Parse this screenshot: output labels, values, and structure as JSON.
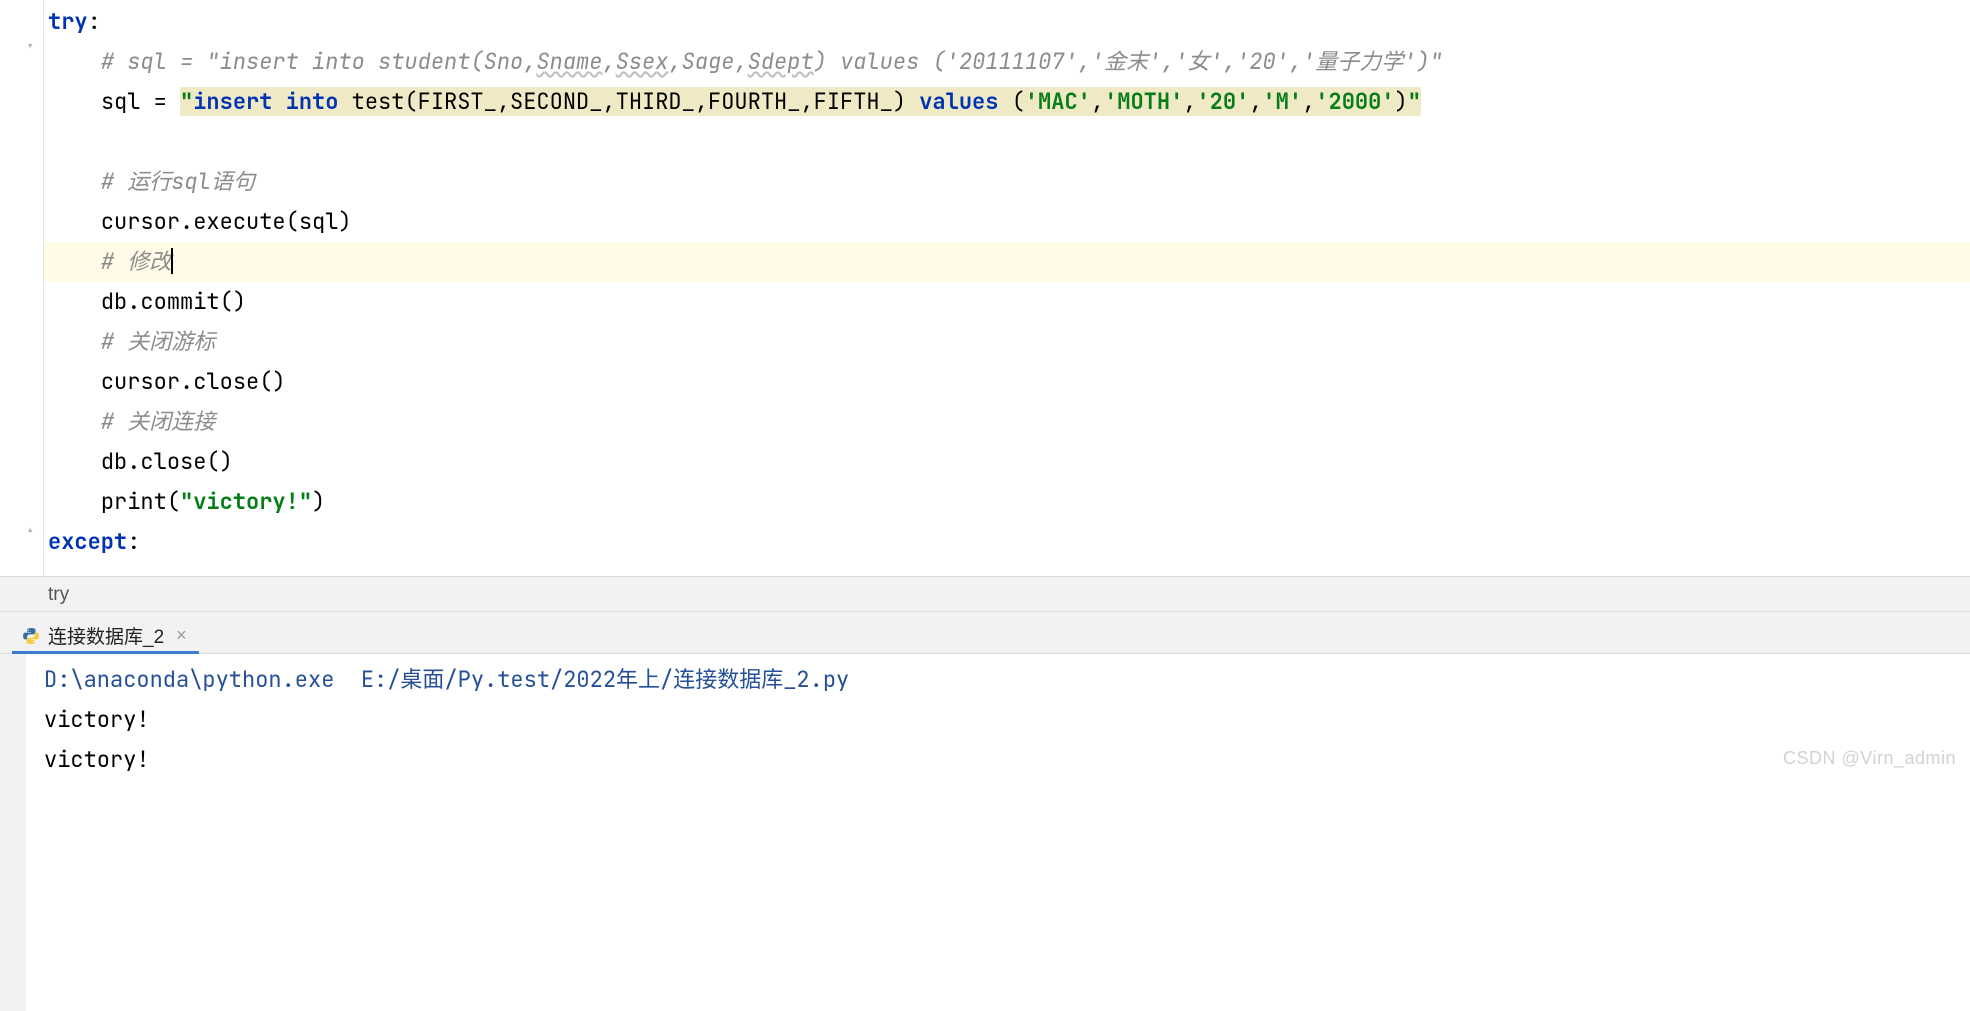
{
  "code": {
    "l1_try": "try",
    "l1_colon": ":",
    "l2_comment": "# sql = \"insert into student(Sno,",
    "l2_u1": "Sname",
    "l2_c2": ",",
    "l2_u2": "Ssex",
    "l2_c3": ",Sage,",
    "l2_u3": "Sdept",
    "l2_c4": ") values ('20111107','金末','女','20','量子力学')\"",
    "l3_var": "sql = ",
    "l3_q": "\"",
    "l3_kw1": "insert into ",
    "l3_mid": "test(FIRST_,SECOND_,THIRD_,FOURTH_,FIFTH_) ",
    "l3_kw2": "values ",
    "l3_paren_open": "(",
    "l3_s1": "'MAC'",
    "l3_s2": "'MOTH'",
    "l3_s3": "'20'",
    "l3_s4": "'M'",
    "l3_s5": "'2000'",
    "l3_comma": ",",
    "l3_paren_close": ")",
    "l5_comment": "# 运行sql语句",
    "l6": "cursor.execute(sql)",
    "l7_comment": "# 修改",
    "l8": "db.commit()",
    "l9_comment": "# 关闭游标",
    "l10": "cursor.close()",
    "l11_comment": "# 关闭连接",
    "l12": "db.close()",
    "l13_a": "print(",
    "l13_str": "\"victory!\"",
    "l13_b": ")",
    "l14": "except",
    "l14_colon": ":"
  },
  "breadcrumb": {
    "text": "try"
  },
  "run_tab": {
    "label": "连接数据库_2"
  },
  "console": {
    "exe_path": "D:\\anaconda\\python.exe",
    "script_path": "E:/桌面/Py.test/2022年上/连接数据库_2.py",
    "out1": "victory!",
    "out2": "victory!"
  },
  "watermark": "CSDN @Virn_admin"
}
